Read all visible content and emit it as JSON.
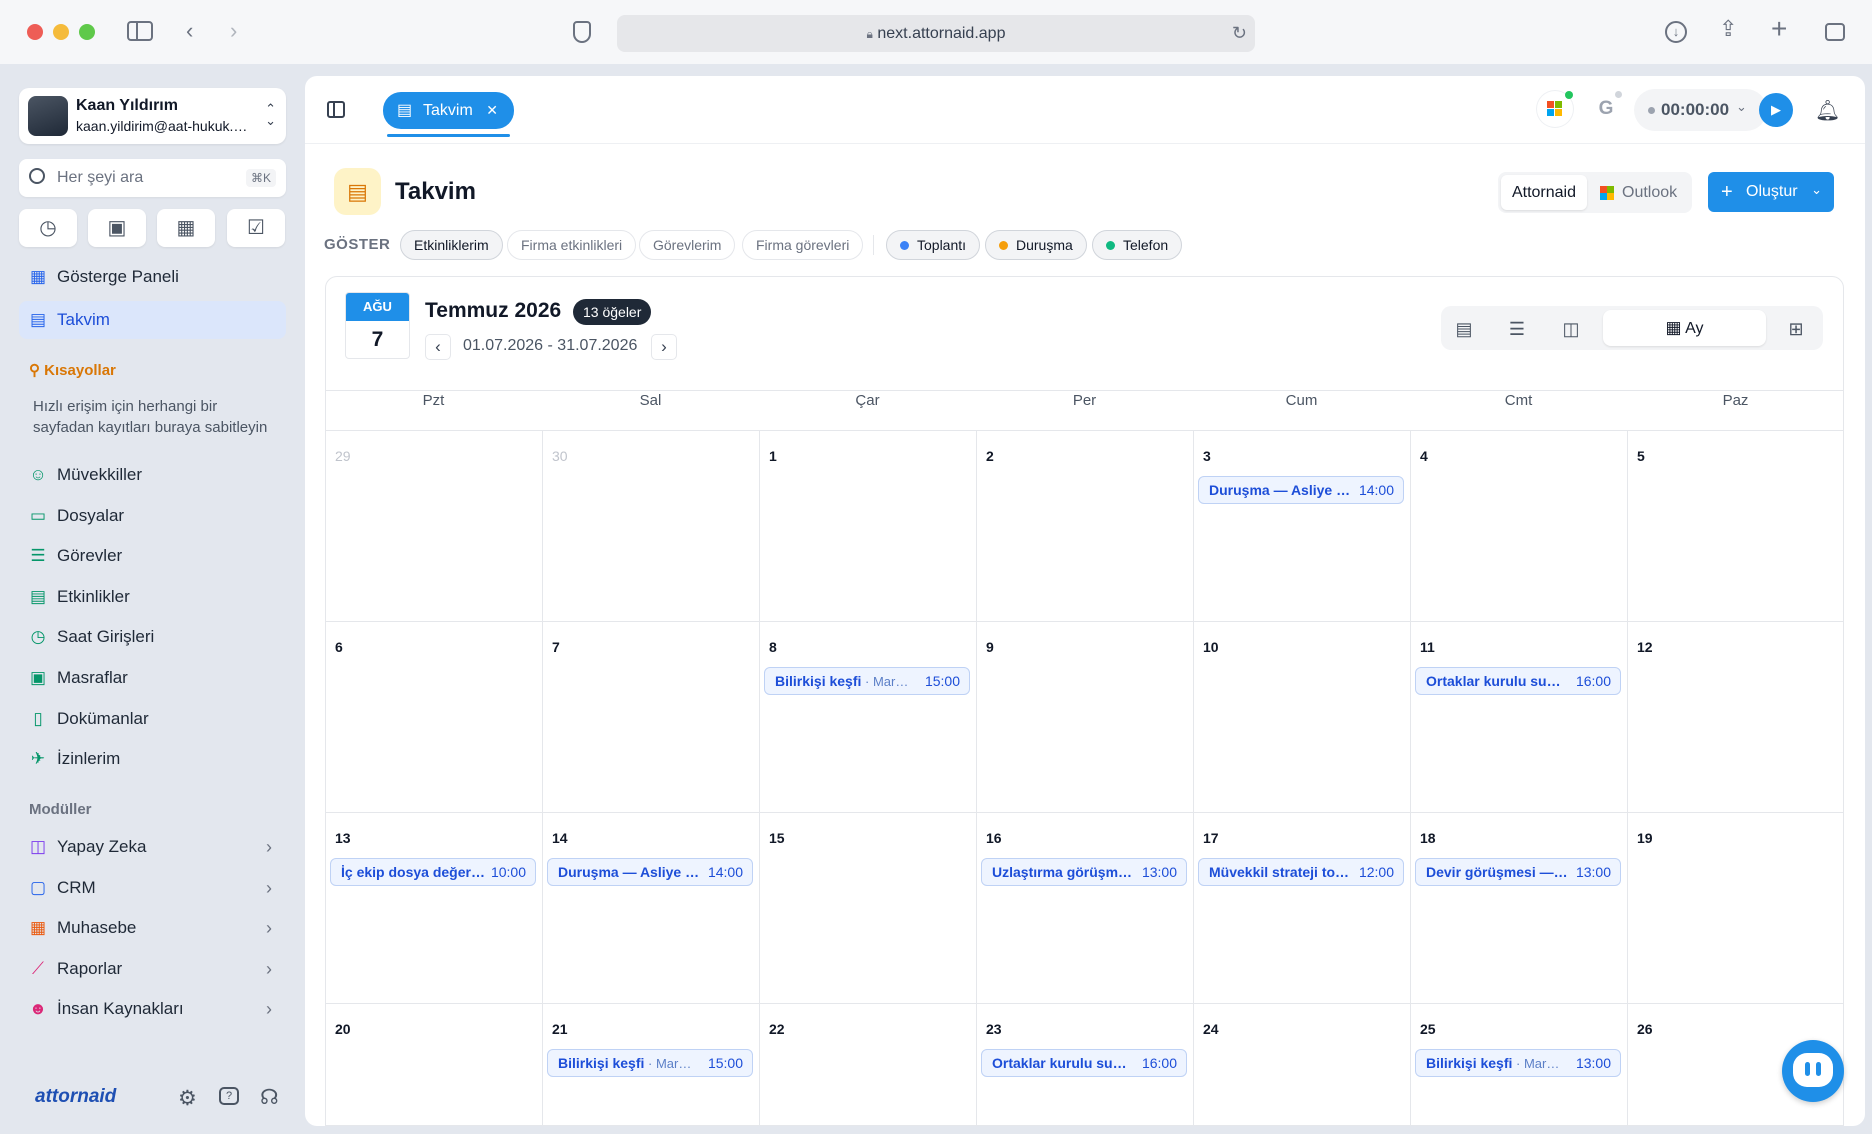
{
  "browser": {
    "url": "next.attornaid.app"
  },
  "user": {
    "name": "Kaan Yıldırım",
    "email": "kaan.yildirim@aat-hukuk.…"
  },
  "search": {
    "placeholder": "Her şeyi ara",
    "shortcut": "⌘K"
  },
  "nav": {
    "main": [
      {
        "label": "Gösterge Paneli",
        "icon": "grid-icon"
      },
      {
        "label": "Takvim",
        "icon": "calendar-icon",
        "active": true
      }
    ],
    "shortcuts_title": "Kısayollar",
    "shortcuts_hint": "Hızlı erişim için herhangi bir sayfadan kayıtları buraya sabitleyin",
    "items": [
      {
        "label": "Müvekkiller",
        "icon": "users-icon"
      },
      {
        "label": "Dosyalar",
        "icon": "folder-icon"
      },
      {
        "label": "Görevler",
        "icon": "tasks-icon"
      },
      {
        "label": "Etkinlikler",
        "icon": "calendar-icon"
      },
      {
        "label": "Saat Girişleri",
        "icon": "clock-icon"
      },
      {
        "label": "Masraflar",
        "icon": "wallet-icon"
      },
      {
        "label": "Dokümanlar",
        "icon": "document-icon"
      },
      {
        "label": "İzinlerim",
        "icon": "plane-icon"
      }
    ],
    "modules_title": "Modüller",
    "modules": [
      {
        "label": "Yapay Zeka",
        "icon": "robot-icon",
        "color": "#7c3aed"
      },
      {
        "label": "CRM",
        "icon": "contact-icon",
        "color": "#2563eb"
      },
      {
        "label": "Muhasebe",
        "icon": "calculator-icon",
        "color": "#ea580c"
      },
      {
        "label": "Raporlar",
        "icon": "chart-icon",
        "color": "#db2777"
      },
      {
        "label": "İnsan Kaynakları",
        "icon": "people-icon",
        "color": "#db2777"
      }
    ],
    "logo": "attornaid"
  },
  "tab": {
    "label": "Takvim"
  },
  "timer": {
    "value": "00:00:00"
  },
  "page": {
    "title": "Takvim",
    "sources": [
      "Attornaid",
      "Outlook"
    ],
    "create_label": "Oluştur",
    "show_label": "GÖSTER",
    "filters": [
      "Etkinliklerim",
      "Firma etkinlikleri",
      "Görevlerim",
      "Firma görevleri"
    ],
    "types": [
      {
        "label": "Toplantı",
        "color": "#3b82f6"
      },
      {
        "label": "Duruşma",
        "color": "#f59e0b"
      },
      {
        "label": "Telefon",
        "color": "#10b981"
      }
    ]
  },
  "calendar": {
    "today_month": "AĞU",
    "today_day": "7",
    "month_title": "Temmuz 2026",
    "count_badge": "13 öğeler",
    "range": "01.07.2026 - 31.07.2026",
    "view_label": "Ay",
    "weekdays": [
      "Pzt",
      "Sal",
      "Çar",
      "Per",
      "Cum",
      "Cmt",
      "Paz"
    ],
    "days": [
      "29",
      "30",
      "1",
      "2",
      "3",
      "4",
      "5",
      "6",
      "7",
      "8",
      "9",
      "10",
      "11",
      "12",
      "13",
      "14",
      "15",
      "16",
      "17",
      "18",
      "19",
      "20",
      "21",
      "22",
      "23",
      "24",
      "25",
      "26"
    ],
    "events": [
      {
        "row": 0,
        "col": 4,
        "title": "Duruşma — Asliye …",
        "sub": "",
        "time": "14:00"
      },
      {
        "row": 1,
        "col": 2,
        "title": "Bilirkişi keşfi",
        "sub": " · Mar…",
        "time": "15:00"
      },
      {
        "row": 1,
        "col": 5,
        "title": "Ortaklar kurulu su…",
        "sub": "",
        "time": "16:00"
      },
      {
        "row": 2,
        "col": 0,
        "title": "İç ekip dosya değer…",
        "sub": "",
        "time": "10:00"
      },
      {
        "row": 2,
        "col": 1,
        "title": "Duruşma — Asliye …",
        "sub": "",
        "time": "14:00"
      },
      {
        "row": 2,
        "col": 3,
        "title": "Uzlaştırma görüşm…",
        "sub": "",
        "time": "13:00"
      },
      {
        "row": 2,
        "col": 4,
        "title": "Müvekkil strateji to…",
        "sub": "",
        "time": "12:00"
      },
      {
        "row": 2,
        "col": 5,
        "title": "Devir görüşmesi —…",
        "sub": "",
        "time": "13:00"
      },
      {
        "row": 3,
        "col": 1,
        "title": "Bilirkişi keşfi",
        "sub": " · Mar…",
        "time": "15:00"
      },
      {
        "row": 3,
        "col": 3,
        "title": "Ortaklar kurulu su…",
        "sub": "",
        "time": "16:00"
      },
      {
        "row": 3,
        "col": 5,
        "title": "Bilirkişi keşfi",
        "sub": " · Mar…",
        "time": "13:00"
      }
    ]
  }
}
